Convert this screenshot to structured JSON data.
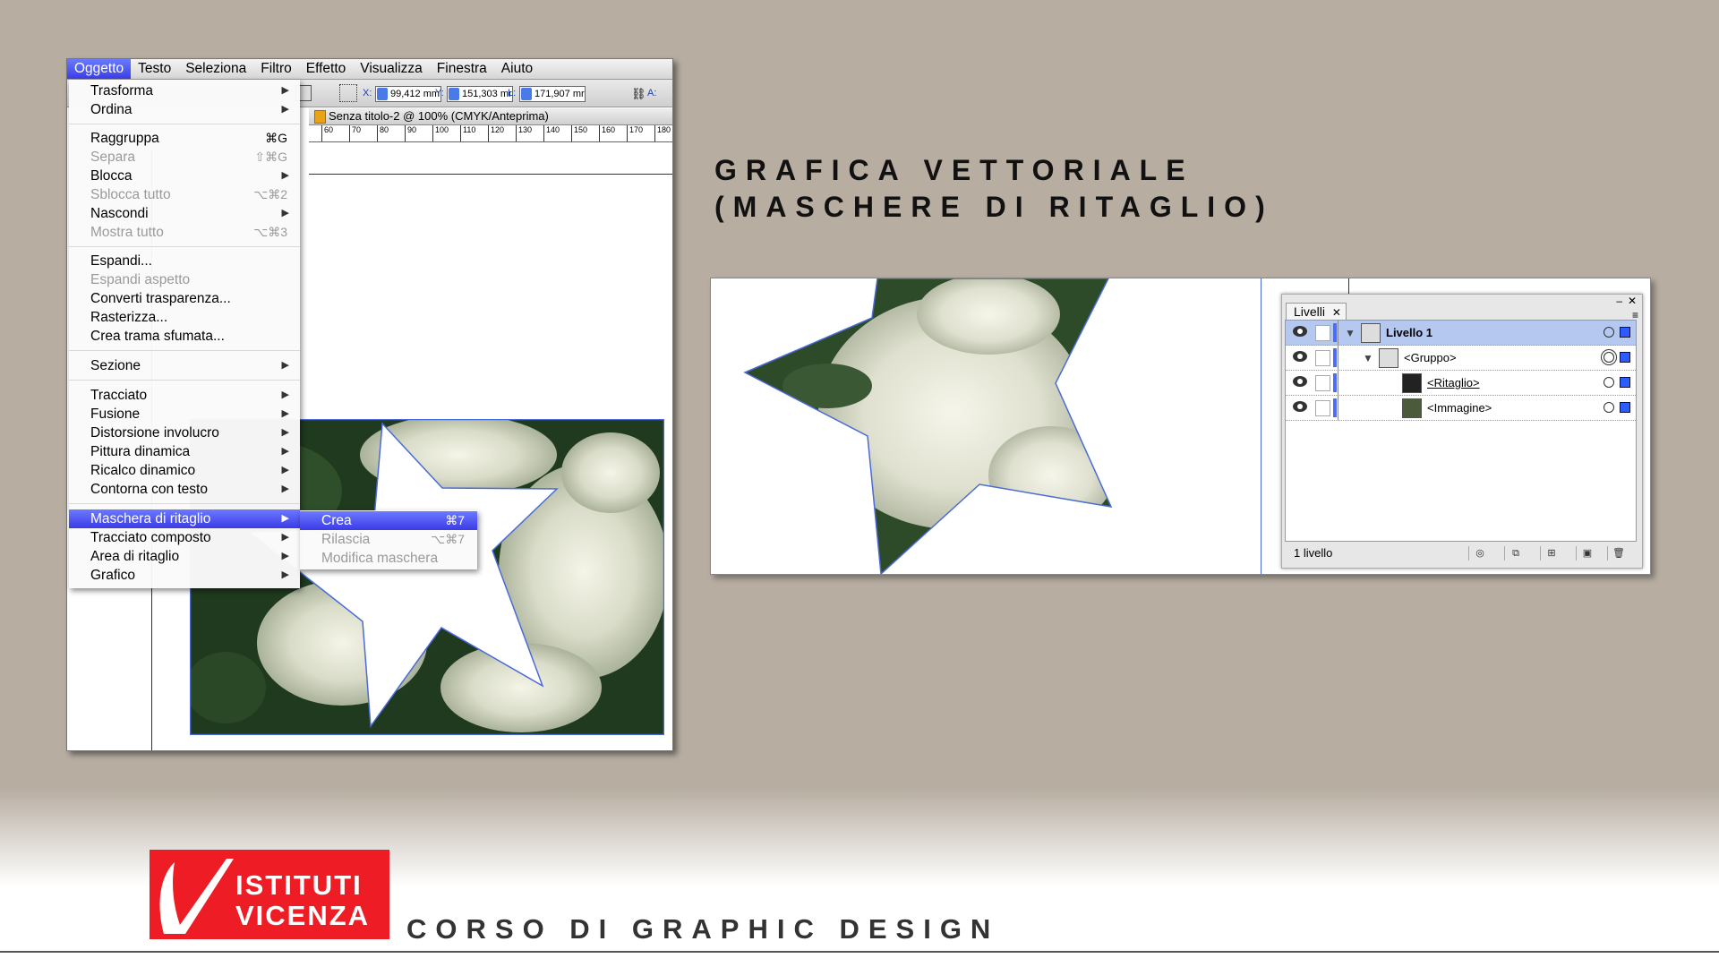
{
  "heading": {
    "line1": "GRAFICA VETTORIALE",
    "line2": "(MASCHERE DI RITAGLIO)"
  },
  "menubar": {
    "items": [
      "Oggetto",
      "Testo",
      "Seleziona",
      "Filtro",
      "Effetto",
      "Visualizza",
      "Finestra",
      "Aiuto"
    ]
  },
  "controlbar": {
    "x_label": "X:",
    "x_value": "99,412 mm",
    "y_label": "Y:",
    "y_value": "151,303 mr",
    "l_label": "L:",
    "l_value": "171,907 mr",
    "a_label": "A:"
  },
  "document": {
    "title": "Senza titolo-2 @ 100% (CMYK/Anteprima)"
  },
  "ruler": {
    "ticks": [
      "60",
      "70",
      "80",
      "90",
      "100",
      "110",
      "120",
      "130",
      "140",
      "150",
      "160",
      "170",
      "180"
    ]
  },
  "menu": {
    "trasforma": "Trasforma",
    "ordina": "Ordina",
    "raggruppa": "Raggruppa",
    "raggruppa_sc": "⌘G",
    "separa": "Separa",
    "separa_sc": "⇧⌘G",
    "blocca": "Blocca",
    "sblocca": "Sblocca tutto",
    "sblocca_sc": "⌥⌘2",
    "nascondi": "Nascondi",
    "mostra": "Mostra tutto",
    "mostra_sc": "⌥⌘3",
    "espandi": "Espandi...",
    "espandi_aspetto": "Espandi aspetto",
    "converti": "Converti trasparenza...",
    "rasterizza": "Rasterizza...",
    "trama": "Crea trama sfumata...",
    "sezione": "Sezione",
    "tracciato": "Tracciato",
    "fusione": "Fusione",
    "distorsione": "Distorsione involucro",
    "pittura": "Pittura dinamica",
    "ricalco": "Ricalco dinamico",
    "contorna": "Contorna con testo",
    "maschera": "Maschera di ritaglio",
    "composto": "Tracciato composto",
    "area": "Area di ritaglio",
    "grafico": "Grafico"
  },
  "submenu": {
    "crea": "Crea",
    "crea_sc": "⌘7",
    "rilascia": "Rilascia",
    "rilascia_sc": "⌥⌘7",
    "modifica": "Modifica maschera"
  },
  "layers_panel": {
    "tab": "Livelli",
    "rows": [
      "Livello 1",
      "<Gruppo>",
      "<Ritaglio>",
      "<Immagine>"
    ],
    "footer": "1 livello"
  },
  "footer": {
    "logo_line1": "ISTITUTI",
    "logo_line2": "VICENZA",
    "course": "CORSO DI GRAPHIC DESIGN"
  },
  "colors": {
    "accent": "#3c3be6",
    "brand_red": "#ee1c25",
    "background": "#b7ada1"
  }
}
